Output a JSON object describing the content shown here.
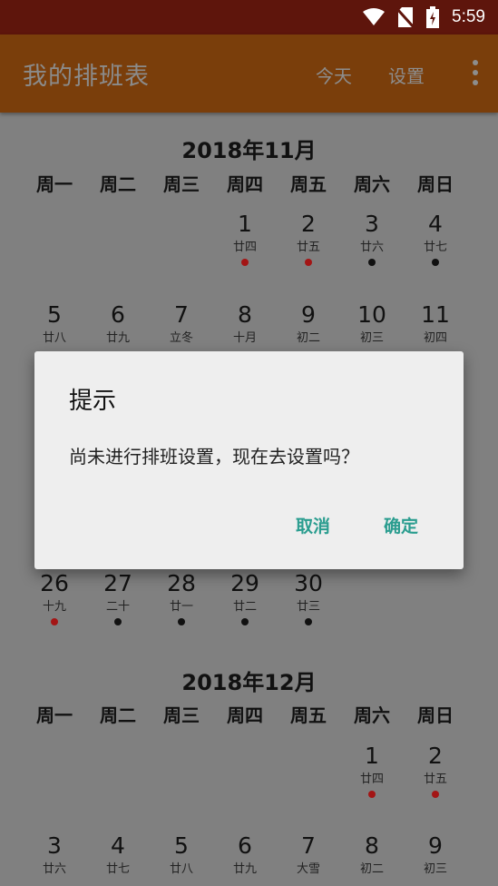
{
  "status": {
    "time": "5:59",
    "icons": [
      "wifi-icon",
      "no-sim-icon",
      "battery-charging-icon"
    ]
  },
  "appbar": {
    "title": "我的排班表",
    "today_label": "今天",
    "settings_label": "设置",
    "overflow_icon": "more-vert-icon"
  },
  "colors": {
    "status_bar": "#5e150c",
    "app_bar": "#7a3e0b",
    "scrim": "#808080",
    "accent": "#2a9d8f",
    "dot_red": "#a31515",
    "dot_black": "#111111"
  },
  "weekdays": [
    "周一",
    "周二",
    "周三",
    "周四",
    "周五",
    "周六",
    "周日"
  ],
  "months": [
    {
      "title": "2018年11月",
      "weeks": [
        [
          null,
          null,
          null,
          {
            "day": "1",
            "lunar": "廿四",
            "dot": "red"
          },
          {
            "day": "2",
            "lunar": "廿五",
            "dot": "red"
          },
          {
            "day": "3",
            "lunar": "廿六",
            "dot": "black"
          },
          {
            "day": "4",
            "lunar": "廿七",
            "dot": "black"
          }
        ],
        [
          {
            "day": "5",
            "lunar": "廿八"
          },
          {
            "day": "6",
            "lunar": "廿九"
          },
          {
            "day": "7",
            "lunar": "立冬"
          },
          {
            "day": "8",
            "lunar": "十月"
          },
          {
            "day": "9",
            "lunar": "初二"
          },
          {
            "day": "10",
            "lunar": "初三"
          },
          {
            "day": "11",
            "lunar": "初四"
          }
        ],
        [
          {
            "day": "26",
            "lunar": "十九",
            "dot": "red"
          },
          {
            "day": "27",
            "lunar": "二十",
            "dot": "black"
          },
          {
            "day": "28",
            "lunar": "廿一",
            "dot": "black"
          },
          {
            "day": "29",
            "lunar": "廿二",
            "dot": "black"
          },
          {
            "day": "30",
            "lunar": "廿三",
            "dot": "black"
          },
          null,
          null
        ]
      ]
    },
    {
      "title": "2018年12月",
      "weeks": [
        [
          null,
          null,
          null,
          null,
          null,
          {
            "day": "1",
            "lunar": "廿四",
            "dot": "red"
          },
          {
            "day": "2",
            "lunar": "廿五",
            "dot": "red"
          }
        ],
        [
          {
            "day": "3",
            "lunar": "廿六"
          },
          {
            "day": "4",
            "lunar": "廿七"
          },
          {
            "day": "5",
            "lunar": "廿八"
          },
          {
            "day": "6",
            "lunar": "廿九"
          },
          {
            "day": "7",
            "lunar": "大雪"
          },
          {
            "day": "8",
            "lunar": "初二"
          },
          {
            "day": "9",
            "lunar": "初三"
          }
        ]
      ]
    }
  ],
  "dialog": {
    "title": "提示",
    "message": "尚未进行排班设置，现在去设置吗？",
    "cancel_label": "取消",
    "confirm_label": "确定"
  }
}
